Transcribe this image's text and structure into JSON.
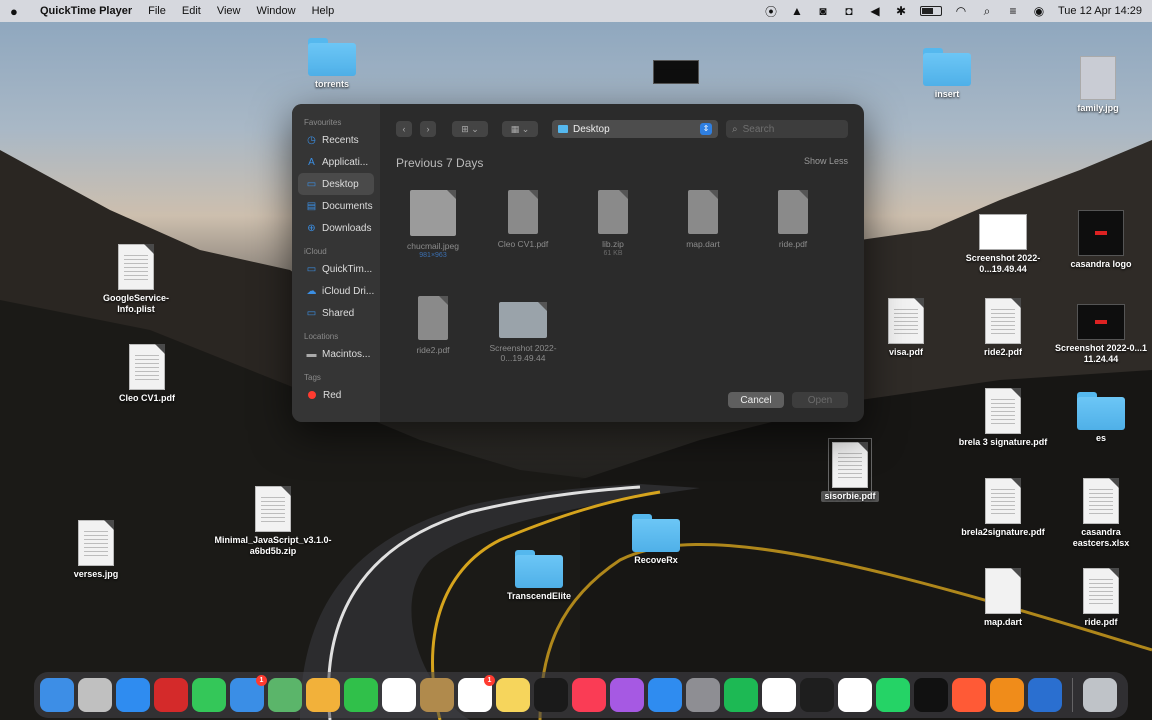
{
  "menubar": {
    "app_name": "QuickTime Player",
    "menus": [
      "File",
      "Edit",
      "View",
      "Window",
      "Help"
    ],
    "clock": "Tue 12 Apr  14:29",
    "battery_level": 0.6
  },
  "desktop": {
    "icons": [
      {
        "name": "folder-torrents",
        "kind": "folder",
        "label": "torrents"
      },
      {
        "name": "thumbnail-image",
        "kind": "thumb",
        "label": ""
      },
      {
        "name": "folder-insert",
        "kind": "folder",
        "label": "insert"
      },
      {
        "name": "family-photo",
        "kind": "thumb",
        "label": "family.jpg"
      },
      {
        "name": "googleservice-plist",
        "kind": "doc",
        "label": "GoogleService-Info.plist"
      },
      {
        "name": "cleo-cv1-pdf",
        "kind": "doc",
        "label": "Cleo CV1.pdf"
      },
      {
        "name": "screenshot-1949",
        "kind": "thumb",
        "label": "Screenshot 2022-0...19.49.44"
      },
      {
        "name": "casandra-logo",
        "kind": "thumb-dark",
        "label": "casandra logo"
      },
      {
        "name": "visa-pdf",
        "kind": "doc",
        "label": "visa.pdf"
      },
      {
        "name": "ride2-pdf",
        "kind": "doc",
        "label": "ride2.pdf"
      },
      {
        "name": "screenshot-1124",
        "kind": "thumb-dark",
        "label": "Screenshot 2022-0...1 11.24.44"
      },
      {
        "name": "brela-signature-pdf",
        "kind": "doc",
        "label": "brela 3 signature.pdf"
      },
      {
        "name": "folder-es",
        "kind": "folder",
        "label": "es"
      },
      {
        "name": "selected-pdf",
        "kind": "doc",
        "label": "sisorbie.pdf"
      },
      {
        "name": "brela2signature-pdf",
        "kind": "doc",
        "label": "brela2signature.pdf"
      },
      {
        "name": "casandra-eastcers",
        "kind": "doc",
        "label": "casandra eastcers.xlsx"
      },
      {
        "name": "verses-jpg",
        "kind": "doc",
        "label": "verses.jpg"
      },
      {
        "name": "minimal-javascript-zip",
        "kind": "doc",
        "label": "Minimal_JavaScript_v3.1.0-a6bd5b.zip"
      },
      {
        "name": "folder-recoverx",
        "kind": "folder",
        "label": "RecoveRx"
      },
      {
        "name": "folder-transcendelite",
        "kind": "folder",
        "label": "TranscendElite"
      },
      {
        "name": "map-dart",
        "kind": "doc",
        "label": "map.dart"
      },
      {
        "name": "ride-pdf",
        "kind": "doc",
        "label": "ride.pdf"
      }
    ]
  },
  "dialog": {
    "sidebar": {
      "favourites_label": "Favourites",
      "favourites": [
        {
          "icon": "◷",
          "label": "Recents",
          "active": false
        },
        {
          "icon": "A",
          "label": "Applicati...",
          "active": false
        },
        {
          "icon": "▭",
          "label": "Desktop",
          "active": true
        },
        {
          "icon": "▤",
          "label": "Documents",
          "active": false
        },
        {
          "icon": "⊕",
          "label": "Downloads",
          "active": false
        }
      ],
      "icloud_label": "iCloud",
      "icloud": [
        {
          "icon": "▭",
          "label": "QuickTim..."
        },
        {
          "icon": "☁",
          "label": "iCloud Dri..."
        },
        {
          "icon": "▭",
          "label": "Shared"
        }
      ],
      "locations_label": "Locations",
      "locations": [
        {
          "icon": "▬",
          "label": "Macintos..."
        }
      ],
      "tags_label": "Tags",
      "tags": [
        {
          "label": "Red",
          "color": "#ff3b30"
        }
      ]
    },
    "toolbar": {
      "back": "‹",
      "forward": "›",
      "icon_view": "⊞ ⌄",
      "group_view": "▦ ⌄",
      "location": "Desktop",
      "search_placeholder": "Search"
    },
    "group_title": "Previous 7 Days",
    "show_less": "Show Less",
    "files": [
      {
        "name": "chucmail.jpeg",
        "sub": "981×963",
        "kind": "jpg"
      },
      {
        "name": "Cleo CV1.pdf",
        "sub": "",
        "kind": "doc"
      },
      {
        "name": "lib.zip",
        "sub": "61 KB",
        "kind": "doc"
      },
      {
        "name": "map.dart",
        "sub": "",
        "kind": "doc"
      },
      {
        "name": "ride.pdf",
        "sub": "",
        "kind": "doc"
      },
      {
        "name": "ride2.pdf",
        "sub": "",
        "kind": "doc"
      },
      {
        "name": "Screenshot 2022-0...19.49.44",
        "sub": "",
        "kind": "shot"
      }
    ],
    "cancel_label": "Cancel",
    "open_label": "Open"
  },
  "dock": {
    "apps": [
      {
        "name": "finder",
        "color": "#3d8ee6",
        "badge": ""
      },
      {
        "name": "launchpad",
        "color": "#c0c0c0",
        "badge": ""
      },
      {
        "name": "safari",
        "color": "#2f8cf0",
        "badge": ""
      },
      {
        "name": "opera",
        "color": "#d42a2a",
        "badge": ""
      },
      {
        "name": "messages",
        "color": "#34c759",
        "badge": ""
      },
      {
        "name": "mail",
        "color": "#3a8ee6",
        "badge": "1"
      },
      {
        "name": "maps",
        "color": "#5bb56a",
        "badge": ""
      },
      {
        "name": "photos",
        "color": "#f2b13a",
        "badge": ""
      },
      {
        "name": "facetime",
        "color": "#30c04a",
        "badge": ""
      },
      {
        "name": "calendar",
        "color": "#ffffff",
        "badge": ""
      },
      {
        "name": "notes-brown",
        "color": "#b08a4c",
        "badge": ""
      },
      {
        "name": "reminders",
        "color": "#ffffff",
        "badge": "1"
      },
      {
        "name": "notes",
        "color": "#f6d55c",
        "badge": ""
      },
      {
        "name": "apple-tv",
        "color": "#1a1a1a",
        "badge": ""
      },
      {
        "name": "music",
        "color": "#fa3c55",
        "badge": ""
      },
      {
        "name": "podcasts",
        "color": "#a659e3",
        "badge": ""
      },
      {
        "name": "app-store",
        "color": "#2f8cf0",
        "badge": ""
      },
      {
        "name": "system-preferences",
        "color": "#8e8e93",
        "badge": ""
      },
      {
        "name": "spotify",
        "color": "#1db954",
        "badge": ""
      },
      {
        "name": "messenger",
        "color": "#ffffff",
        "badge": ""
      },
      {
        "name": "figma",
        "color": "#1e1e1e",
        "badge": ""
      },
      {
        "name": "chrome",
        "color": "#ffffff",
        "badge": ""
      },
      {
        "name": "whatsapp",
        "color": "#25d366",
        "badge": ""
      },
      {
        "name": "pycharm",
        "color": "#111111",
        "badge": ""
      },
      {
        "name": "pencil-app",
        "color": "#ff5a36",
        "badge": ""
      },
      {
        "name": "vlc",
        "color": "#f08c1a",
        "badge": ""
      },
      {
        "name": "quicktime",
        "color": "#2a6fd0",
        "badge": ""
      },
      {
        "name": "trash",
        "color": "#bfc3c8",
        "badge": ""
      }
    ]
  },
  "colors": {
    "accent": "#2f7fe0",
    "folder": "#55b8ee",
    "dialog_bg": "#2b2b2b"
  }
}
